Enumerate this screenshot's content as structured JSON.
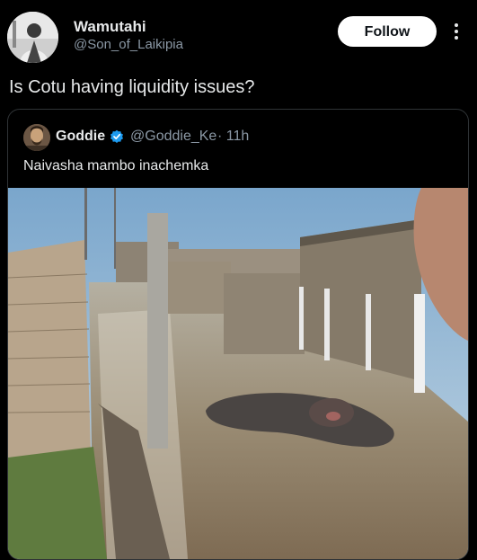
{
  "author": {
    "name": "Wamutahi",
    "handle": "@Son_of_Laikipia"
  },
  "follow_label": "Follow",
  "tweet_text": "Is Cotu having liquidity issues?",
  "quoted": {
    "name": "Goddie",
    "handle": "@Goddie_Ke",
    "time": "· 11h",
    "text": "Naivasha mambo inachemka"
  },
  "icons": {
    "more": "more-vertical-icon",
    "verified": "verified-badge-icon"
  },
  "colors": {
    "background": "#000000",
    "text": "#e7e9ea",
    "muted": "#8b98a5",
    "verified": "#1d9bf0",
    "card_border": "#2f3336"
  }
}
